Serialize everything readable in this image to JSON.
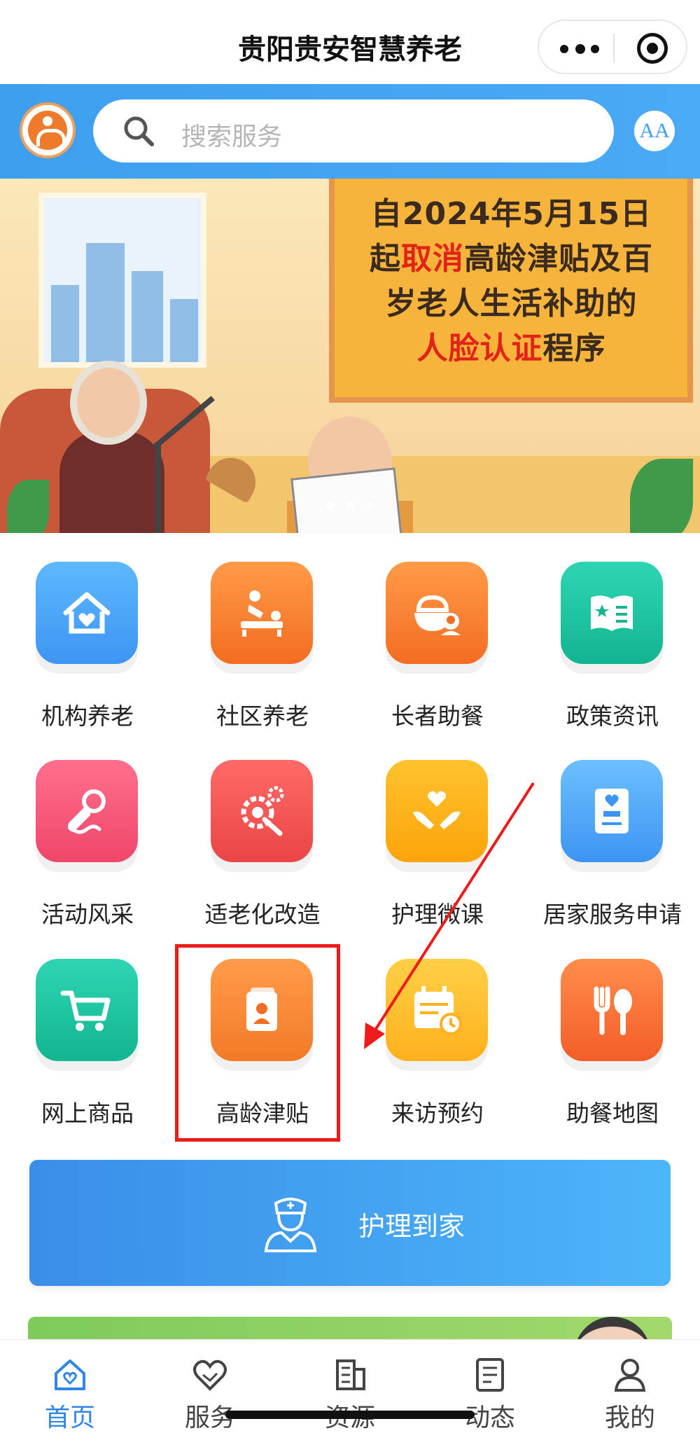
{
  "header": {
    "title": "贵阳贵安智慧养老"
  },
  "search": {
    "placeholder": "搜索服务"
  },
  "font_size_button": "AA",
  "banner": {
    "lines": [
      {
        "parts": [
          {
            "text": "自2024年5月15日",
            "hl": false
          }
        ]
      },
      {
        "parts": [
          {
            "text": "起",
            "hl": false
          },
          {
            "text": "取消",
            "hl": true
          },
          {
            "text": "高龄津贴及百",
            "hl": false
          }
        ]
      },
      {
        "parts": [
          {
            "text": "岁老人生活补助的",
            "hl": false
          }
        ]
      },
      {
        "parts": [
          {
            "text": "人脸认证",
            "hl": true
          },
          {
            "text": "程序",
            "hl": false
          }
        ]
      }
    ],
    "highlight_color": "#e2231a",
    "slide_count": 3,
    "active_slide": 1
  },
  "services": [
    {
      "label": "机构养老",
      "icon": "house-heart-icon",
      "color": "blue"
    },
    {
      "label": "社区养老",
      "icon": "massage-icon",
      "color": "orange"
    },
    {
      "label": "长者助餐",
      "icon": "meal-bowl-icon",
      "color": "orange"
    },
    {
      "label": "政策资讯",
      "icon": "policy-book-icon",
      "color": "green"
    },
    {
      "label": "活动风采",
      "icon": "microphone-icon",
      "color": "pink"
    },
    {
      "label": "适老化改造",
      "icon": "renovation-gear-icon",
      "color": "red"
    },
    {
      "label": "护理微课",
      "icon": "care-hands-icon",
      "color": "amber"
    },
    {
      "label": "居家服务申请",
      "icon": "home-service-form-icon",
      "color": "sky"
    },
    {
      "label": "网上商品",
      "icon": "cart-icon",
      "color": "green"
    },
    {
      "label": "高龄津贴",
      "icon": "allowance-card-icon",
      "color": "orange"
    },
    {
      "label": "来访预约",
      "icon": "calendar-clock-icon",
      "color": "yellow"
    },
    {
      "label": "助餐地图",
      "icon": "fork-spoon-icon",
      "color": "orange"
    }
  ],
  "care_button": {
    "label": "护理到家",
    "icon": "nurse-icon"
  },
  "tabs": [
    {
      "label": "首页",
      "icon": "home-icon",
      "active": true
    },
    {
      "label": "服务",
      "icon": "handshake-heart-icon",
      "active": false
    },
    {
      "label": "资源",
      "icon": "building-icon",
      "active": false
    },
    {
      "label": "动态",
      "icon": "news-doc-icon",
      "active": false
    },
    {
      "label": "我的",
      "icon": "user-icon",
      "active": false
    }
  ],
  "colors": {
    "primary_blue": "#3e9ef0",
    "active_tab": "#2f86e8",
    "annotation_red": "#ee1b1b"
  }
}
